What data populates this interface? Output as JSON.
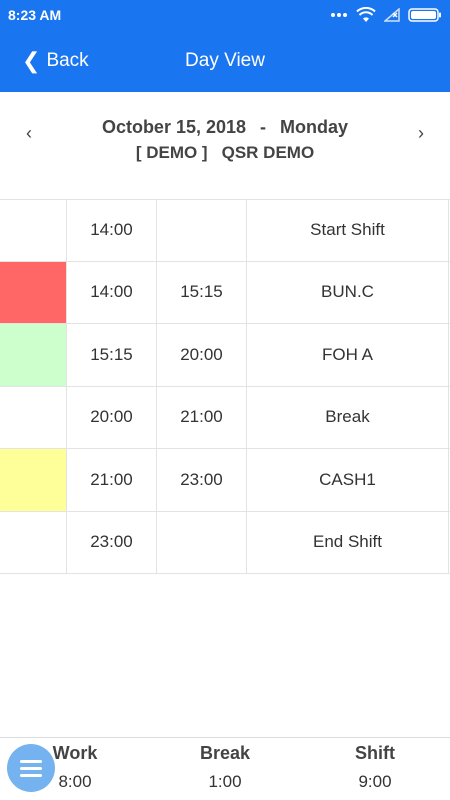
{
  "status_bar": {
    "time": "8:23 AM",
    "icons": [
      "dots-icon",
      "wifi-icon",
      "signal-icon",
      "battery-icon"
    ]
  },
  "app_bar": {
    "back_label": "Back",
    "title": "Day View",
    "color": "#1a75f0"
  },
  "date_header": {
    "date": "October 15, 2018",
    "separator": "-",
    "weekday": "Monday",
    "store_tag": "[ DEMO ]",
    "store_name": "QSR DEMO",
    "prev_icon": "chevron-left-icon",
    "next_icon": "chevron-right-icon"
  },
  "schedule": {
    "rows": [
      {
        "color": "#ffffff",
        "start": "14:00",
        "end": "",
        "task": "Start Shift"
      },
      {
        "color": "#ff6666",
        "start": "14:00",
        "end": "15:15",
        "task": "BUN.C"
      },
      {
        "color": "#ccffcc",
        "start": "15:15",
        "end": "20:00",
        "task": "FOH A"
      },
      {
        "color": "#ffffff",
        "start": "20:00",
        "end": "21:00",
        "task": "Break"
      },
      {
        "color": "#ffff99",
        "start": "21:00",
        "end": "23:00",
        "task": "CASH1"
      },
      {
        "color": "#ffffff",
        "start": "23:00",
        "end": "",
        "task": "End Shift"
      }
    ]
  },
  "summary": {
    "work": {
      "label": "Work",
      "value": "8:00"
    },
    "break": {
      "label": "Break",
      "value": "1:00"
    },
    "shift": {
      "label": "Shift",
      "value": "9:00"
    }
  },
  "fab": {
    "icon": "menu-icon",
    "color": "#74b3ef"
  }
}
